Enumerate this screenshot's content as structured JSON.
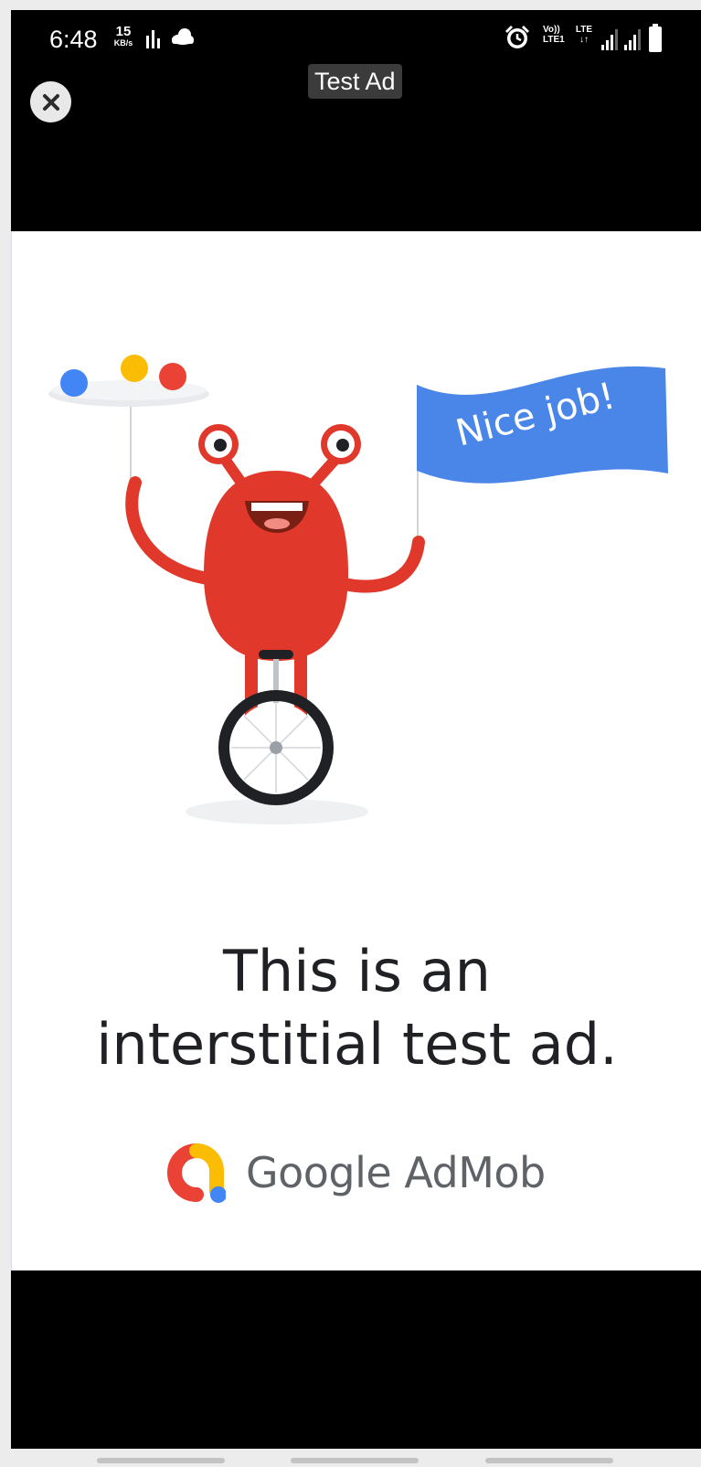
{
  "status_bar": {
    "time": "6:48",
    "net_speed_value": "15",
    "net_speed_unit": "KB/s",
    "volte_top": "Vo))",
    "volte_bottom": "LTE1",
    "lte_label": "LTE",
    "icons": [
      "activity-bars-icon",
      "cloud-icon",
      "alarm-icon",
      "signal-icon",
      "battery-icon"
    ]
  },
  "ad": {
    "close_icon": "close-icon",
    "badge_label": "Test Ad",
    "flag_text": "Nice job!",
    "headline_line1": "This is an",
    "headline_line2": "interstitial test ad.",
    "brand_name": "Google AdMob"
  },
  "colors": {
    "blue": "#4285f4",
    "red": "#ea4335",
    "yellow": "#fbbc04",
    "monster_red": "#e0382b",
    "text_dark": "#202124",
    "text_gray": "#5f6368"
  },
  "nav_bar": {
    "items": [
      "recents-handle",
      "home-handle",
      "back-handle"
    ]
  }
}
